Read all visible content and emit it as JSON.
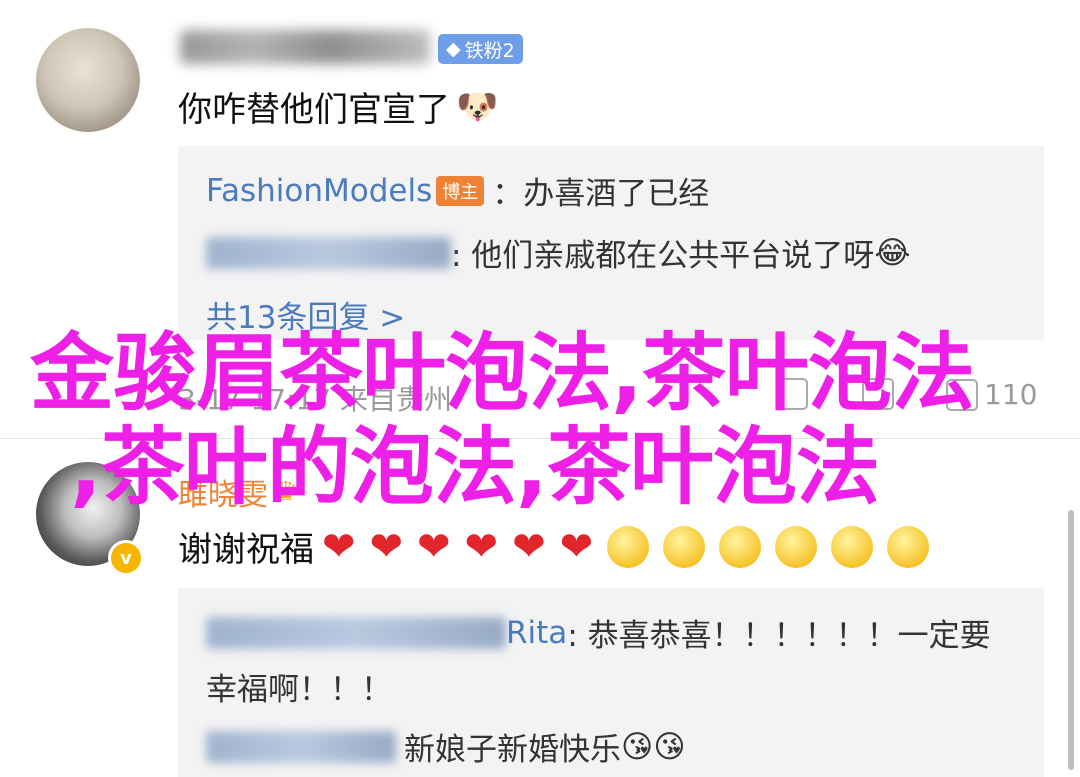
{
  "comment1": {
    "badge": "铁粉2",
    "text": "你咋替他们官宣了",
    "emoji": "🐶"
  },
  "replies1": {
    "r1_name": "FashionModels",
    "r1_badge": "博主",
    "r1_text": "：办喜酒了已经",
    "r2_text": ": 他们亲戚都在公共平台说了呀",
    "r2_emoji": "😂",
    "more": "共13条回复 >"
  },
  "meta": {
    "time_location": "3-17 17:17 来自贵州",
    "like_count": "110"
  },
  "comment2": {
    "username": "雎晓雯",
    "text": "谢谢祝福",
    "hearts": [
      "❤",
      "❤",
      "❤",
      "❤",
      "❤",
      "❤"
    ],
    "faces": [
      "🥰",
      "🥰",
      "🥰",
      "🥰",
      "🥰",
      "🥰"
    ]
  },
  "replies2": {
    "r1_name_tail": "Rita",
    "r1_text": ": 恭喜恭喜！！！！！！一定要",
    "r1_text_cont": "幸福啊！！！",
    "r2_text": "新娘子新婚快乐",
    "r2_emojis": [
      "😘",
      "😘"
    ]
  },
  "overlay": {
    "line1": "金骏眉茶叶泡法,茶叶泡法",
    "line2": ",茶叶的泡法,茶叶泡法"
  }
}
